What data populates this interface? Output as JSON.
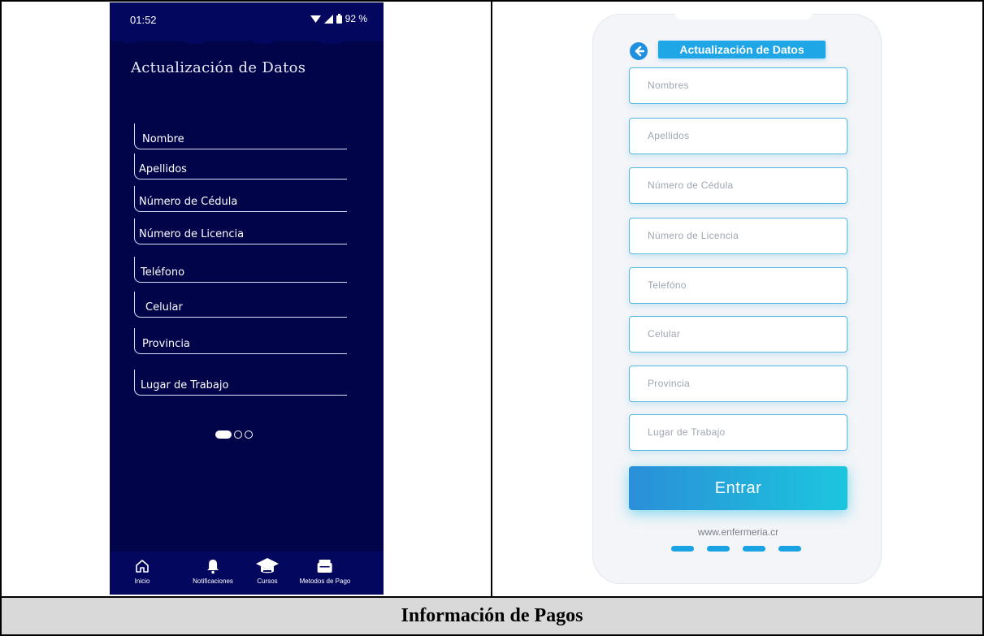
{
  "left_phone": {
    "status": {
      "time": "01:52",
      "battery": "92 %"
    },
    "title": "Actualización de Datos",
    "fields": [
      "Nombre",
      "Apellidos",
      "Número de Cédula",
      "Número de Licencia",
      "Teléfono",
      "Celular",
      "Provincia",
      "Lugar de Trabajo"
    ],
    "pager": {
      "pages": 3,
      "current": 1
    },
    "nav": [
      {
        "label": "Inicio",
        "icon": "home-icon"
      },
      {
        "label": "Notificaciones",
        "icon": "bell-icon"
      },
      {
        "label": "Cursos",
        "icon": "graduation-cap-icon"
      },
      {
        "label": "Metodos de Pago",
        "icon": "wallet-icon"
      }
    ]
  },
  "right_mockup": {
    "title": "Actualización de Datos",
    "fields": [
      "Nombres",
      "Apellidos",
      "Número de Cédula",
      "Número de Licencia",
      "Telefóno",
      "Celular",
      "Provincia",
      "Lugar de Trabajo"
    ],
    "button_label": "Entrar",
    "url": "www.enfermeria.cr",
    "pager": {
      "pages": 4
    }
  },
  "caption": "Información de Pagos",
  "colors": {
    "dark_navy": "#02044a",
    "accent_blue": "#1fa6e6",
    "field_border": "#53b9de"
  }
}
